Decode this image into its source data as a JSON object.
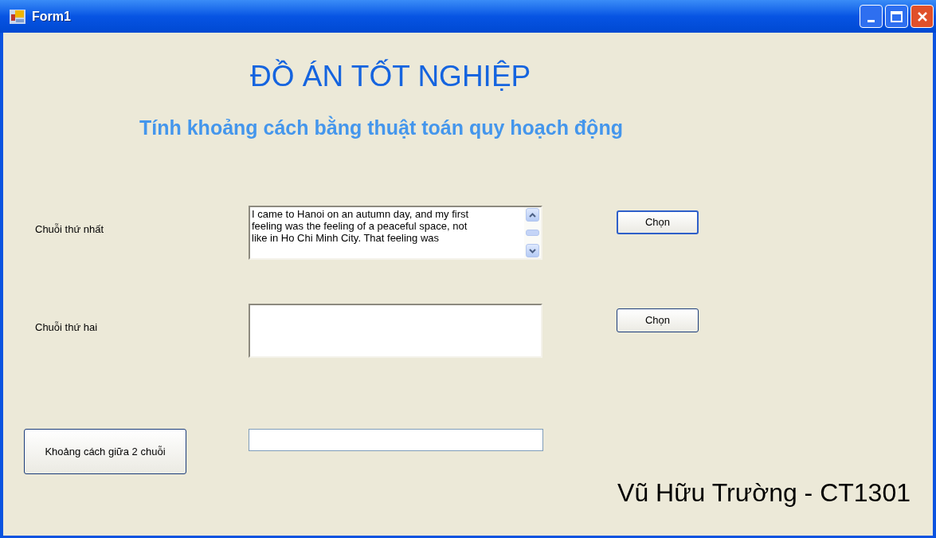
{
  "window": {
    "title": "Form1"
  },
  "heading": "ĐỒ ÁN TỐT NGHIỆP",
  "subheading": "Tính khoảng cách bằng thuật toán quy hoạch động",
  "rows": [
    {
      "label": "Chuỗi thứ nhất",
      "value_lines": [
        "I came to Hanoi on an autumn day, and my first",
        "feeling was the feeling of a peaceful space, not",
        "like in Ho Chi Minh City. That feeling was"
      ],
      "scrollbar": true,
      "button": "Chọn",
      "focused": true
    },
    {
      "label": "Chuỗi thứ hai",
      "value_lines": [],
      "scrollbar": false,
      "button": "Chọn",
      "focused": false
    }
  ],
  "compute_button": "Khoảng cách giữa 2 chuỗi",
  "author": "Vũ Hữu Trường - CT1301"
}
